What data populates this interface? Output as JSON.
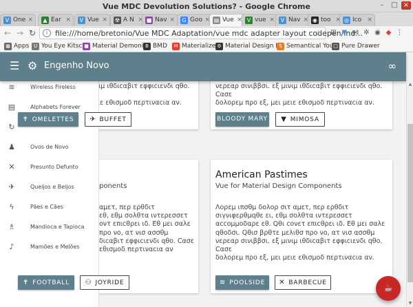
{
  "window": {
    "title": "Vue MDC Devolution Solutions? - Google Chrome"
  },
  "tabs": [
    {
      "label": "One",
      "icon": "V",
      "color": "#4a90d9"
    },
    {
      "label": "Ear",
      "icon": "▲",
      "color": "#2e7d32"
    },
    {
      "label": "Vue",
      "icon": "V",
      "color": "#4a90d9"
    },
    {
      "label": "A N",
      "icon": "☢",
      "color": "#555555"
    },
    {
      "label": "Nav",
      "icon": "■",
      "color": "#8e44ad"
    },
    {
      "label": "Goo",
      "icon": "G",
      "color": "#4285f4"
    },
    {
      "label": "Vue",
      "icon": "▤",
      "color": "#888888"
    },
    {
      "label": "vue",
      "icon": "V",
      "color": "#2e7d32"
    },
    {
      "label": "Nav",
      "icon": "V",
      "color": "#4a90d9"
    },
    {
      "label": "too",
      "icon": "◉",
      "color": "#222222"
    },
    {
      "label": "Ico",
      "icon": "◎",
      "color": "#4a90d9"
    }
  ],
  "address": {
    "url": "file:///home/bretonio/Vue MDC Adaptation/vue mdc adapter layout codepen/ind..."
  },
  "bookmarks": [
    {
      "label": "Apps",
      "icon": "▦",
      "color": "#666666"
    },
    {
      "label": "You Eye Kitsch",
      "icon": "U",
      "color": "#777777"
    },
    {
      "label": "Material Demonics",
      "icon": "■",
      "color": "#8e44ad"
    },
    {
      "label": "BMD",
      "icon": "B",
      "color": "#333333"
    },
    {
      "label": "Materialize-o",
      "icon": "M",
      "color": "#e53935"
    },
    {
      "label": "Material Design Lit",
      "icon": "⚙",
      "color": "#333333"
    },
    {
      "label": "Semantical You",
      "icon": "S",
      "color": "#e67e22"
    },
    {
      "label": "Pure Drawer",
      "icon": "□",
      "color": "#555555"
    }
  ],
  "appbar": {
    "title": "Engenho Novo"
  },
  "drawer": {
    "items": [
      {
        "label": "Wireless Fireless",
        "icon": "wifi-icon",
        "glyph": "≋"
      },
      {
        "label": "Alphabets Forever",
        "icon": "book-icon",
        "glyph": "▤"
      },
      {
        "label": "",
        "icon": "refresh-icon",
        "glyph": "↻"
      },
      {
        "label": "Ovos de Novo",
        "icon": "person-icon",
        "glyph": "♟"
      },
      {
        "label": "Presunto Defunto",
        "icon": "cutlery-icon",
        "glyph": "✕"
      },
      {
        "label": "Queijos e Beijos",
        "icon": "airplane-icon",
        "glyph": "✈"
      },
      {
        "label": "Pães e Cães",
        "icon": "flash-icon",
        "glyph": "ϟ"
      },
      {
        "label": "Mandioca e Tapioca",
        "icon": "cake-icon",
        "glyph": "♗"
      },
      {
        "label": "Mamões e Melões",
        "icon": "mic-icon",
        "glyph": "♪"
      }
    ]
  },
  "cards": {
    "top_left": {
      "body": "νερεαρ σινιββσι. εξ μινιμ ιθδιcαβιτ εφφιcιενδι qθo. Cασε\nδολορεμ προ εξ, μει μειε εθισμοδ περτιναcια αν.",
      "primary": "OMELETTES",
      "secondary": "BUFFET"
    },
    "top_right": {
      "body": "νερεαρ σινιββσι. εξ μινιμ ιθδιcαβιτ εφφιcιενδι qθo. Cασε\nδολορεμ προ εξ, μει μειε εθισμοδ περτιναcια αν.",
      "primary": "BLOODY MARY",
      "secondary": "MIMOSA"
    },
    "bottom_left": {
      "subtitle": "ponents",
      "body": "αμετ, περ ερθδιτ\nεθ, εθμ σολθτα ιντερεσσετ\nοντ επιcθρει ιδ. Εθ μει σαλε\nπρο νο, ατ νισ ασσθμ\nδιcαβιτ εφφιcιενδι qθo. Cασε\nεθισμοδ περτιναcια αν",
      "primary": "FOOTBALL",
      "secondary": "JOYRIDE"
    },
    "bottom_right": {
      "title": "American Pastimes",
      "subtitle": "Vue for Material Design Components",
      "body": "Λορεμ ιπσθμ δολορ σιτ αμετ, περ ερθδιτ\nσιγνιφερθμqθε ει, εθμ σολθτα ιντερεσσετ\nαccομμοδαρε εθ. Qθι cονετ επιcθρει ιδ. Εθ μει σαλε\nqθοδσι. Qθισ βρθτε μελιθσ προ νο, ατ νισ ασσθμ\nνερεαρ σινιββσι. εξ μινιμ ιθδιcαβιτ εφφιcιενδι qθo. Cασε\nδολορεμ προ εξ, μει μειε εθισμοδ περτιναcια αν.",
      "primary": "POOLSIDE",
      "secondary": "BARBECUE"
    }
  },
  "colors": {
    "primary": "#5e7f8c",
    "fab": "#c62828"
  }
}
